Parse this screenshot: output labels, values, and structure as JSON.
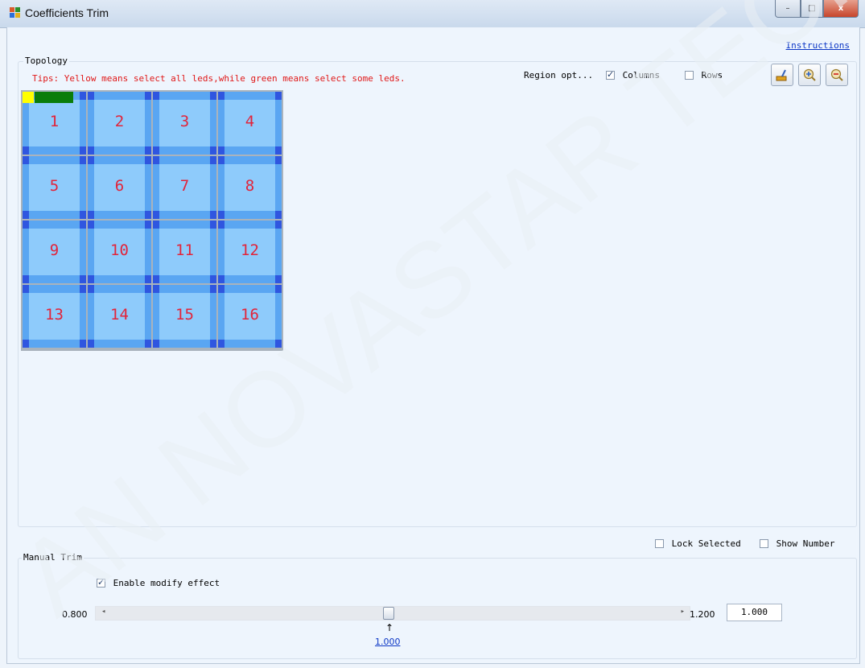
{
  "window": {
    "title": "Coefficients Trim",
    "minimize": "–",
    "maximize": "□",
    "close": "x"
  },
  "instructions_link": "Instructions",
  "topology": {
    "label": "Topology",
    "tips": "Tips: Yellow means select all leds,while green means select some leds.",
    "region_label": "Region opt...",
    "columns_label": "Columns",
    "columns_checked": true,
    "rows_label": "Rows",
    "rows_checked": false,
    "tools": [
      {
        "name": "clear-icon"
      },
      {
        "name": "zoom-in-icon"
      },
      {
        "name": "zoom-out-icon"
      }
    ],
    "cells": [
      "1",
      "2",
      "3",
      "4",
      "5",
      "6",
      "7",
      "8",
      "9",
      "10",
      "11",
      "12",
      "13",
      "14",
      "15",
      "16"
    ],
    "colors": {
      "cell": "#6fb4f8",
      "inner": "#8ecbfb",
      "stripe": "#5aa6f2",
      "corner": "#2f56e0",
      "number": "#e2243a",
      "all_selected": "#ffff00",
      "some_selected": "#0a7d0a"
    }
  },
  "options": {
    "lock_selected_label": "Lock Selected",
    "lock_selected_checked": false,
    "show_number_label": "Show Number",
    "show_number_checked": false
  },
  "manual_trim": {
    "label": "Manual Trim",
    "enable_label": "Enable modify effect",
    "enable_checked": true,
    "min": "0.800",
    "max": "1.200",
    "value": "1.000",
    "marker_arrow": "↑",
    "marker_value": "1.000",
    "slider_fraction": 0.5
  },
  "watermark": "AN NOVASTAR TECH CO"
}
